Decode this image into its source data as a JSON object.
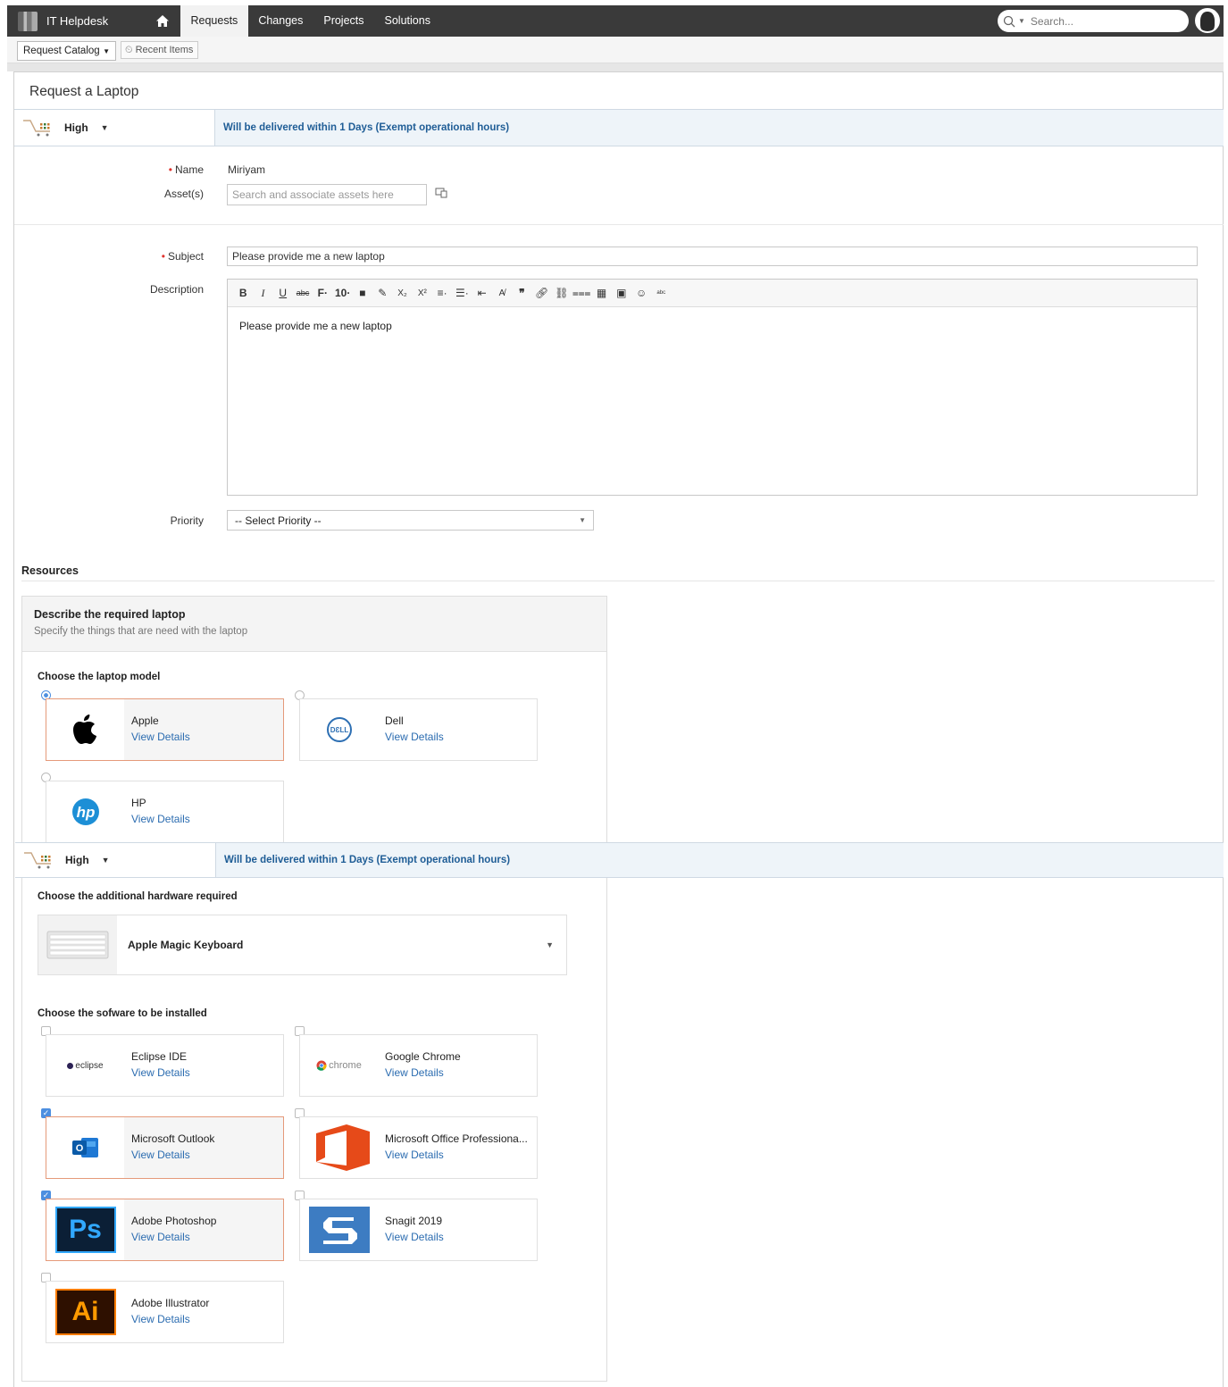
{
  "nav": {
    "app_title": "IT Helpdesk",
    "tabs": [
      "Requests",
      "Changes",
      "Projects",
      "Solutions"
    ],
    "active_tab": "Requests",
    "search_placeholder": "Search..."
  },
  "subbar": {
    "catalog_label": "Request Catalog",
    "recent_label": "Recent Items"
  },
  "form": {
    "title": "Request a Laptop",
    "sla": {
      "priority": "High",
      "text": "Will be delivered within 1 Days (Exempt operational hours)"
    },
    "name_label": "Name",
    "name_value": "Miriyam",
    "assets_label": "Asset(s)",
    "assets_placeholder": "Search and associate assets here",
    "subject_label": "Subject",
    "subject_value": "Please provide me a new laptop",
    "description_label": "Description",
    "toolbar": {
      "font_size": "10"
    },
    "description_value": "Please provide me a new laptop",
    "priority_label": "Priority",
    "priority_value": "-- Select Priority --"
  },
  "resources": {
    "title": "Resources",
    "box_title": "Describe the required laptop",
    "box_subtitle": "Specify the things that are need with the laptop",
    "model_question": "Choose the laptop model",
    "models": [
      {
        "name": "Apple",
        "link": "View Details",
        "selected": true
      },
      {
        "name": "Dell",
        "link": "View Details",
        "selected": false
      },
      {
        "name": "HP",
        "link": "View Details",
        "selected": false
      }
    ],
    "hardware_question": "Choose the additional hardware required",
    "hardware_value": "Apple Magic Keyboard",
    "software_question": "Choose the sofware to be installed",
    "software": [
      {
        "name": "Eclipse IDE",
        "link": "View Details",
        "checked": false,
        "logo_text": "eclipse"
      },
      {
        "name": "Google Chrome",
        "link": "View Details",
        "checked": false,
        "logo_text": "chrome"
      },
      {
        "name": "Microsoft Outlook",
        "link": "View Details",
        "checked": true
      },
      {
        "name": "Microsoft Office Professiona...",
        "link": "View Details",
        "checked": false
      },
      {
        "name": "Adobe Photoshop",
        "link": "View Details",
        "checked": true,
        "logo_text": "Ps"
      },
      {
        "name": "Snagit 2019",
        "link": "View Details",
        "checked": false
      },
      {
        "name": "Adobe Illustrator",
        "link": "View Details",
        "checked": false,
        "logo_text": "Ai"
      }
    ]
  },
  "colors": {
    "nav_bg": "#3a3a3a",
    "link": "#2b6cb0",
    "sla_text": "#1f5d96",
    "selected_border": "#e59a7a",
    "required": "#e0322d"
  }
}
